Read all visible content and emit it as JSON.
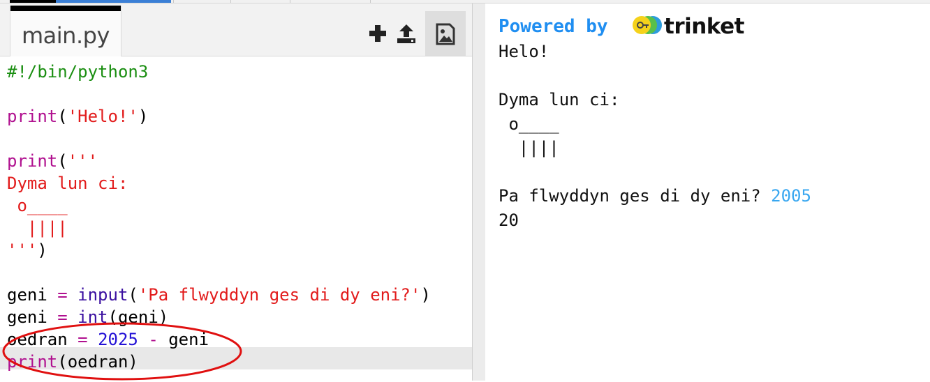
{
  "editor": {
    "tab_label": "main.py",
    "tools": [
      "add-file-icon",
      "upload-icon",
      "image-icon"
    ],
    "code_lines": [
      [
        {
          "t": "#!/bin/python3",
          "c": "k-green"
        }
      ],
      [],
      [
        {
          "t": "print",
          "c": "k-mag"
        },
        {
          "t": "(",
          "c": ""
        },
        {
          "t": "'Helo!'",
          "c": "k-str"
        },
        {
          "t": ")",
          "c": ""
        }
      ],
      [],
      [
        {
          "t": "print",
          "c": "k-mag"
        },
        {
          "t": "(",
          "c": ""
        },
        {
          "t": "'''",
          "c": "k-str"
        }
      ],
      [
        {
          "t": "Dyma lun ci:",
          "c": "k-str"
        }
      ],
      [
        {
          "t": " o____",
          "c": "k-str"
        }
      ],
      [
        {
          "t": "  ||||",
          "c": "k-str"
        }
      ],
      [
        {
          "t": "'''",
          "c": "k-str"
        },
        {
          "t": ")",
          "c": ""
        }
      ],
      [],
      [
        {
          "t": "geni ",
          "c": ""
        },
        {
          "t": "=",
          "c": "k-op"
        },
        {
          "t": " ",
          "c": ""
        },
        {
          "t": "input",
          "c": "k-builtin"
        },
        {
          "t": "(",
          "c": ""
        },
        {
          "t": "'Pa flwyddyn ges di dy eni?'",
          "c": "k-str"
        },
        {
          "t": ")",
          "c": ""
        }
      ],
      [
        {
          "t": "geni ",
          "c": ""
        },
        {
          "t": "=",
          "c": "k-op"
        },
        {
          "t": " ",
          "c": ""
        },
        {
          "t": "int",
          "c": "k-builtin"
        },
        {
          "t": "(geni)",
          "c": ""
        }
      ],
      [
        {
          "t": "oedran ",
          "c": ""
        },
        {
          "t": "=",
          "c": "k-op"
        },
        {
          "t": " ",
          "c": ""
        },
        {
          "t": "2025",
          "c": "k-num"
        },
        {
          "t": " ",
          "c": ""
        },
        {
          "t": "-",
          "c": "k-op"
        },
        {
          "t": " geni",
          "c": ""
        }
      ],
      [
        {
          "t": "print",
          "c": "k-mag"
        },
        {
          "t": "(oedran)",
          "c": ""
        }
      ]
    ]
  },
  "output": {
    "powered_by": "Powered by",
    "brand": "trinket",
    "lines": [
      {
        "text": "Helo!"
      },
      {
        "text": ""
      },
      {
        "text": "Dyma lun ci:"
      },
      {
        "text": " o____"
      },
      {
        "text": "  ||||"
      },
      {
        "text": ""
      },
      {
        "text": "Pa flwyddyn ges di dy eni? ",
        "input": "2005"
      },
      {
        "text": "20"
      }
    ]
  },
  "colors": {
    "accent": "#1f8ef1",
    "string": "#e21b1b",
    "keyword": "#b0108f",
    "comment": "#1a8e11",
    "number": "#2412d6",
    "input_echo": "#39a7f0",
    "annotation": "#e01010"
  }
}
